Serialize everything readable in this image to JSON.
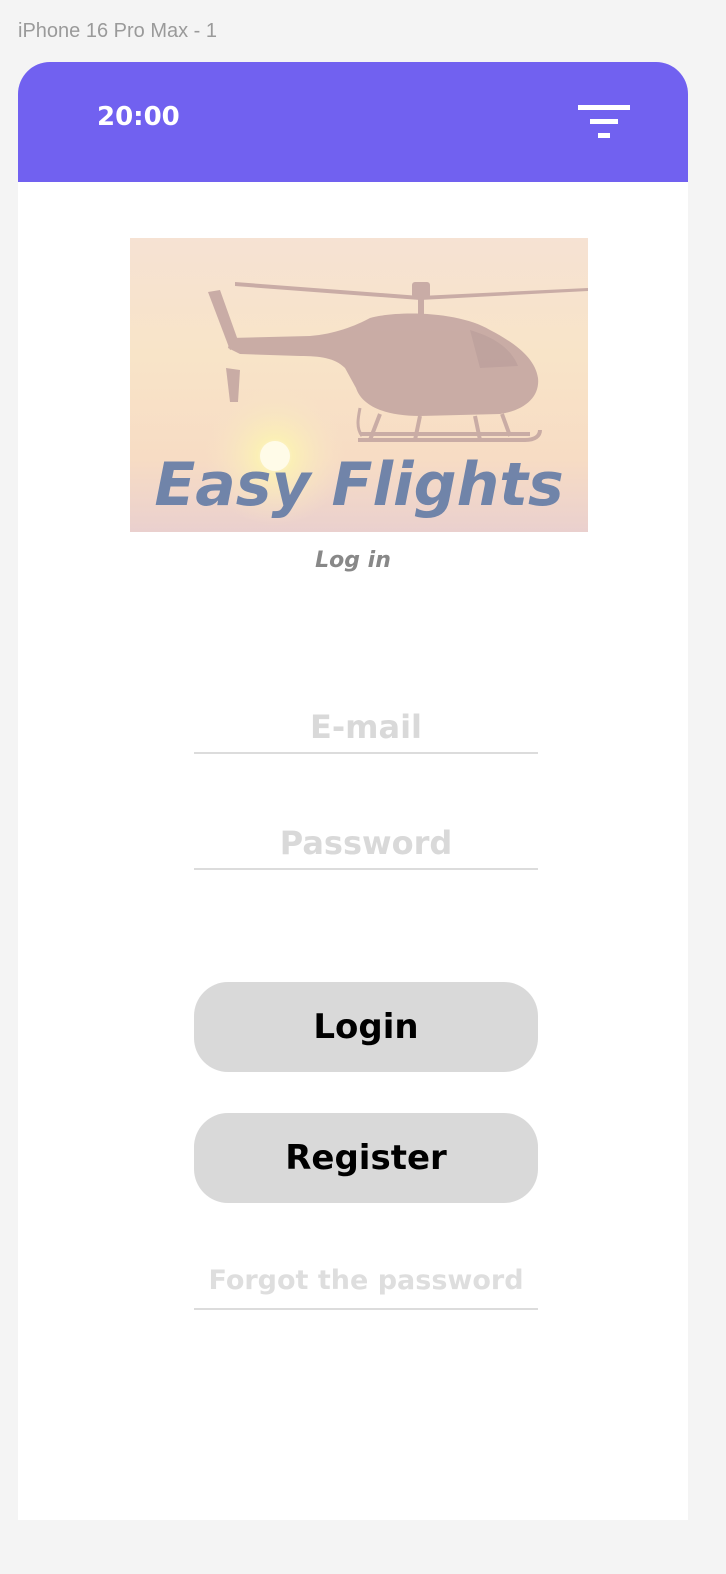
{
  "frame": {
    "label": "iPhone 16 Pro Max - 1"
  },
  "status_bar": {
    "time": "20:00",
    "menu_icon": "filter-menu-icon"
  },
  "hero": {
    "brand": "Easy Flights",
    "image": "helicopter-sunset"
  },
  "screen": {
    "title": "Log in"
  },
  "form": {
    "email_placeholder": "E-mail",
    "password_placeholder": "Password",
    "login_label": "Login",
    "register_label": "Register",
    "forgot_label": "Forgot the password"
  },
  "colors": {
    "header": "#7161f0",
    "button": "#d9d9d9",
    "brand_text": "#6a80a8",
    "placeholder": "#d9d9d9"
  }
}
